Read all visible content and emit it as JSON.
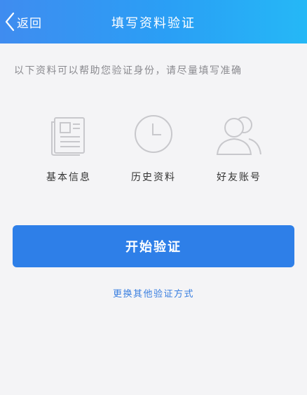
{
  "header": {
    "back_label": "返回",
    "title": "填写资料验证"
  },
  "description": "以下资料可以帮助您验证身份，请尽量填写准确",
  "options": [
    {
      "label": "基本信息",
      "icon": "document-icon"
    },
    {
      "label": "历史资料",
      "icon": "clock-icon"
    },
    {
      "label": "好友账号",
      "icon": "friends-icon"
    }
  ],
  "start_button": "开始验证",
  "other_link": "更换其他验证方式",
  "colors": {
    "header_gradient_start": "#3f8cf0",
    "header_gradient_end": "#25b8f6",
    "primary_button": "#2e7fe8",
    "link": "#3a7fe0",
    "icon_gray": "#c8c8cc"
  }
}
